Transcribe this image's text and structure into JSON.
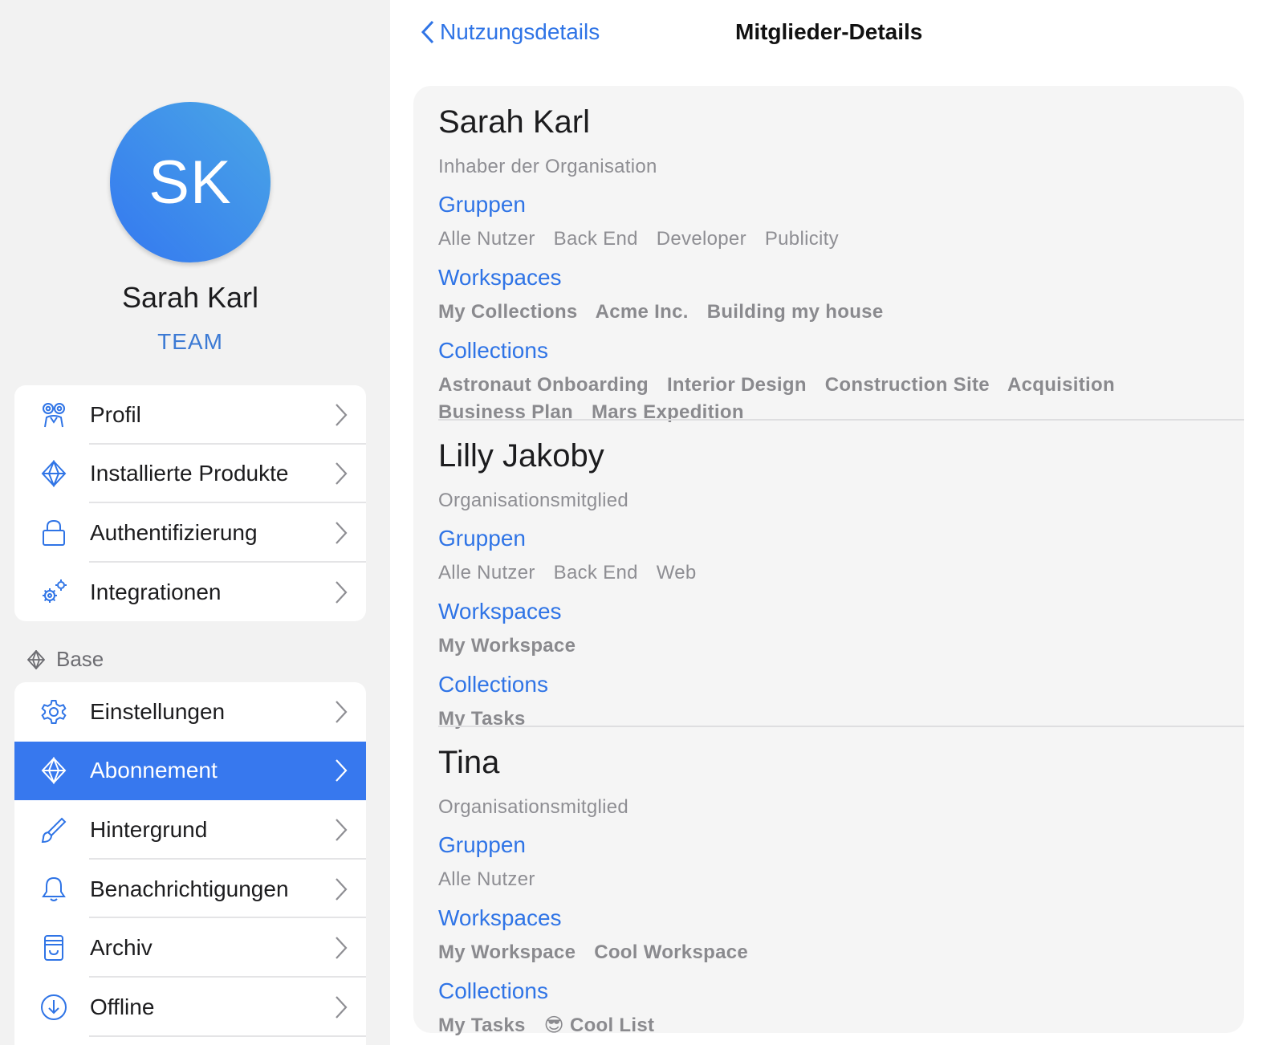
{
  "sidebar": {
    "avatar_initials": "SK",
    "profile_name": "Sarah Karl",
    "plan": "TEAM",
    "account_items": [
      {
        "label": "Profil",
        "icon": "profile-icon"
      },
      {
        "label": "Installierte Produkte",
        "icon": "diamond-icon"
      },
      {
        "label": "Authentifizierung",
        "icon": "lock-icon"
      },
      {
        "label": "Integrationen",
        "icon": "gears-icon"
      }
    ],
    "section_label": "Base",
    "base_items": [
      {
        "label": "Einstellungen",
        "icon": "gear-icon"
      },
      {
        "label": "Abonnement",
        "icon": "diamond-icon",
        "active": true
      },
      {
        "label": "Hintergrund",
        "icon": "brush-icon"
      },
      {
        "label": "Benachrichtigungen",
        "icon": "bell-icon"
      },
      {
        "label": "Archiv",
        "icon": "archive-icon"
      },
      {
        "label": "Offline",
        "icon": "download-circle-icon"
      }
    ]
  },
  "header": {
    "back_label": "Nutzungsdetails",
    "title": "Mitglieder-Details"
  },
  "labels": {
    "groups": "Gruppen",
    "workspaces": "Workspaces",
    "collections": "Collections"
  },
  "members": [
    {
      "name": "Sarah Karl",
      "role": "Inhaber der Organisation",
      "groups": [
        "Alle Nutzer",
        "Back End",
        "Developer",
        "Publicity"
      ],
      "workspaces": [
        "My Collections",
        "Acme Inc.",
        "Building my house"
      ],
      "collections": [
        "Astronaut Onboarding",
        "Interior Design",
        "Construction Site",
        "Acquisition",
        "Business Plan",
        "Mars Expedition"
      ]
    },
    {
      "name": "Lilly Jakoby",
      "role": "Organisationsmitglied",
      "groups": [
        "Alle Nutzer",
        "Back End",
        "Web"
      ],
      "workspaces": [
        "My Workspace"
      ],
      "collections": [
        "My Tasks"
      ]
    },
    {
      "name": "Tina",
      "role": "Organisationsmitglied",
      "groups": [
        "Alle Nutzer"
      ],
      "workspaces": [
        "My Workspace",
        "Cool Workspace"
      ],
      "collections": [
        "My Tasks",
        "😎 Cool List"
      ]
    }
  ],
  "colors": {
    "accent": "#2f74e6",
    "active_row": "#3778ee",
    "secondary_text": "#8e8e93"
  }
}
